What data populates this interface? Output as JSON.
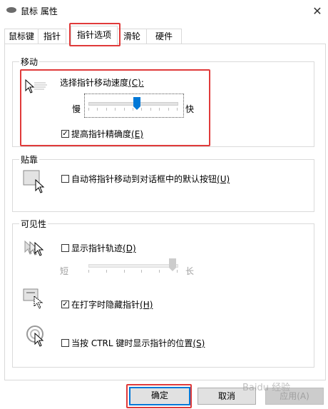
{
  "window": {
    "title": "鼠标 属性",
    "close_glyph": "✕"
  },
  "tabs": [
    {
      "label": "鼠标键"
    },
    {
      "label": "指针"
    },
    {
      "label": "指针选项"
    },
    {
      "label": "滑轮"
    },
    {
      "label": "硬件"
    }
  ],
  "motion": {
    "title": "移动",
    "speed_label": "选择指针移动速度",
    "speed_accel": "(C):",
    "slow_label": "慢",
    "fast_label": "快",
    "speed_value": 0.55,
    "precision_label": "提高指针精确度",
    "precision_accel": "(E)",
    "precision_checked": true
  },
  "snap": {
    "title": "贴靠",
    "snap_label": "自动将指针移动到对话框中的默认按钮",
    "snap_accel": "(U)",
    "snap_checked": false
  },
  "visibility": {
    "title": "可见性",
    "trail_label": "显示指针轨迹",
    "trail_accel": "(D)",
    "trail_checked": false,
    "short_label": "短",
    "long_label": "长",
    "trail_value": 1.0,
    "hide_label": "在打字时隐藏指针",
    "hide_accel": "(H)",
    "hide_checked": true,
    "ctrl_label": "当按 CTRL 键时显示指针的位置",
    "ctrl_accel": "(S)",
    "ctrl_checked": false
  },
  "buttons": {
    "ok": "确定",
    "cancel": "取消",
    "apply": "应用(A)"
  },
  "watermark": "Baidu 经验",
  "colors": {
    "accent": "#0078d7",
    "highlight": "#e03a3a"
  }
}
